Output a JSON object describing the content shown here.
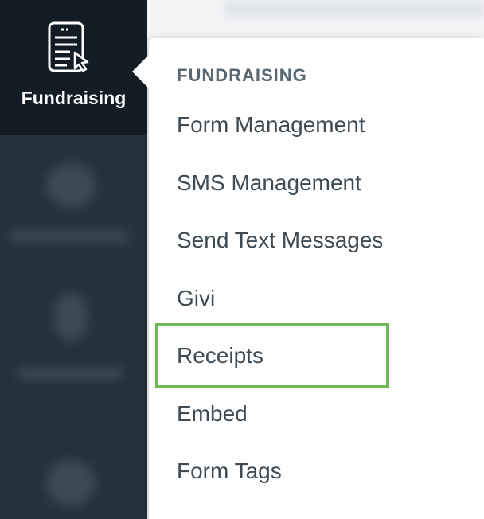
{
  "sidebar": {
    "active_item": {
      "label": "Fundraising",
      "icon": "fundraising-form-icon"
    }
  },
  "menu": {
    "heading": "FUNDRAISING",
    "items": [
      {
        "label": "Form Management"
      },
      {
        "label": "SMS Management"
      },
      {
        "label": "Send Text Messages"
      },
      {
        "label": "Givi"
      },
      {
        "label": "Receipts",
        "highlighted": true
      },
      {
        "label": "Embed"
      },
      {
        "label": "Form Tags"
      }
    ],
    "highlight_color": "#6fbb57"
  },
  "colors": {
    "sidebar_bg": "#23333f",
    "sidebar_active_bg": "#141d25",
    "menu_text": "#3f4a52",
    "heading_text": "#5a6770"
  }
}
